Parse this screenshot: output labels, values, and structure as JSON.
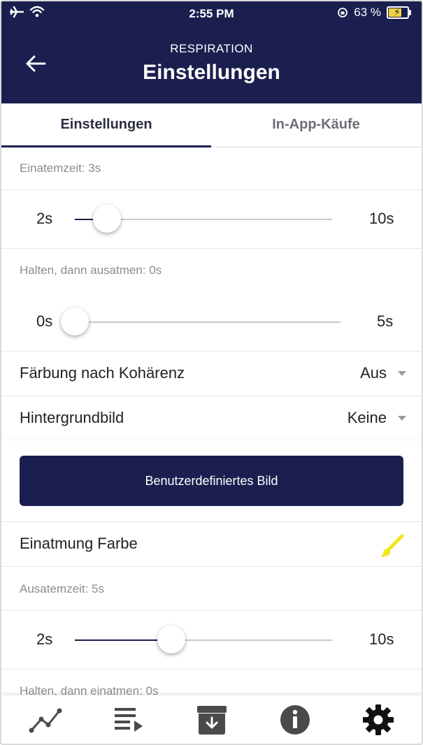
{
  "status_bar": {
    "time": "2:55 PM",
    "battery_percent": "63 %",
    "battery_level": 0.63
  },
  "header": {
    "subtitle": "RESPIRATION",
    "title": "Einstellungen"
  },
  "tabs": [
    {
      "label": "Einstellungen",
      "active": true
    },
    {
      "label": "In-App-Käufe",
      "active": false
    }
  ],
  "settings": {
    "inhale_time": {
      "label": "Einatemzeit: 3s",
      "min": "2s",
      "max": "10s",
      "value": 3,
      "range": [
        2,
        10
      ]
    },
    "hold_exhale": {
      "label": "Halten, dann ausatmen: 0s",
      "min": "0s",
      "max": "5s",
      "value": 0,
      "range": [
        0,
        5
      ]
    },
    "coherence_coloring": {
      "label": "Färbung nach Kohärenz",
      "value": "Aus"
    },
    "background_image": {
      "label": "Hintergrundbild",
      "value": "Keine"
    },
    "custom_image_button": "Benutzerdefiniertes Bild",
    "inhale_color": {
      "label": "Einatmung Farbe",
      "color": "#f2e51b"
    },
    "exhale_time": {
      "label": "Ausatemzeit: 5s",
      "min": "2s",
      "max": "10s",
      "value": 5,
      "range": [
        2,
        10
      ]
    },
    "hold_inhale": {
      "label": "Halten, dann einatmen: 0s"
    }
  },
  "bottom_nav": [
    {
      "icon": "line-chart-icon"
    },
    {
      "icon": "playlist-icon"
    },
    {
      "icon": "archive-download-icon"
    },
    {
      "icon": "info-icon"
    },
    {
      "icon": "gear-icon",
      "active": true
    }
  ],
  "colors": {
    "primary": "#1b1f4f",
    "slider_track": "#c9c9c9",
    "nav_icon": "#4a4a4a"
  }
}
